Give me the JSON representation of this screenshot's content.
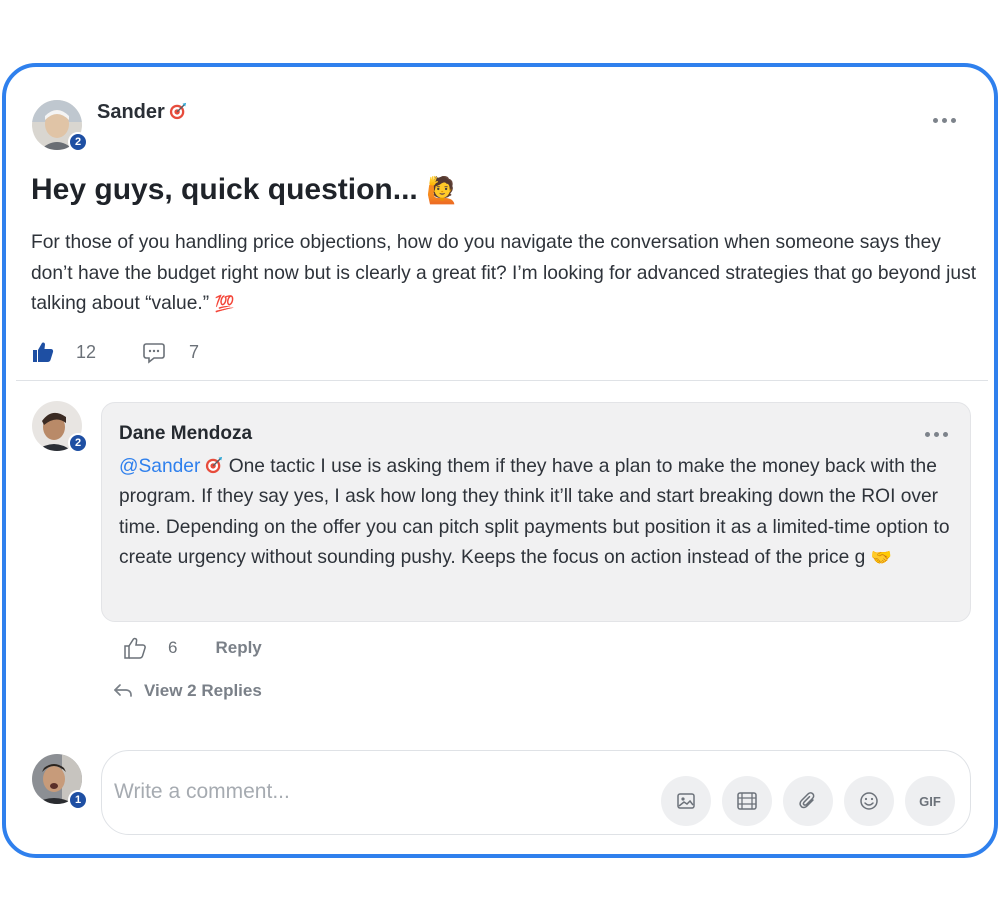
{
  "post": {
    "author": "Sander",
    "author_badge_level": "2",
    "title": "Hey guys, quick question...",
    "title_emoji": "🙋",
    "body": "For those of you handling price objections, how do you navigate the conversation when someone says they don’t have the budget right now but is clearly a great fit? I’m looking for advanced strategies that go beyond just talking about “value.”",
    "body_emoji": "💯",
    "likes": "12",
    "comments": "7"
  },
  "comment": {
    "author": "Dane Mendoza",
    "author_badge_level": "2",
    "mention": "@Sander",
    "text": " One tactic I use is asking them if they have a plan to make the money back with the program. If they say yes, I ask how long they think it’ll take and start breaking down the ROI over time. Depending on the offer you can pitch split payments but position it as a limited-time option to create urgency without sounding pushy. Keeps the focus on action instead of the price g ",
    "text_emoji": "🤝",
    "likes": "6",
    "reply_label": "Reply",
    "view_replies_label": "View 2 Replies"
  },
  "composer": {
    "user_badge_level": "1",
    "placeholder": "Write a comment...",
    "gif_label": "GIF",
    "tools": [
      "image-icon",
      "video-icon",
      "attach-icon",
      "emoji-icon",
      "gif-icon"
    ]
  },
  "colors": {
    "accent": "#2f80ed",
    "badge": "#1e4fa3",
    "like_active": "#1e4fa3"
  }
}
